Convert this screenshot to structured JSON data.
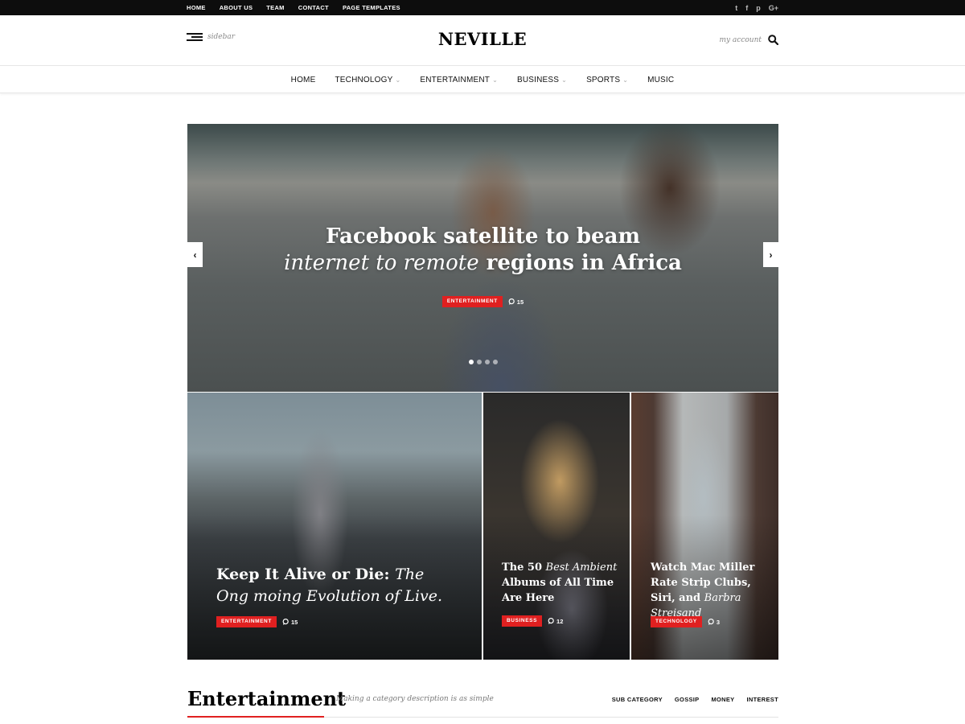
{
  "top_nav": [
    "HOME",
    "ABOUT US",
    "TEAM",
    "CONTACT",
    "PAGE TEMPLATES"
  ],
  "social": [
    {
      "icon": "twitter-icon",
      "glyph": "t"
    },
    {
      "icon": "facebook-icon",
      "glyph": "f"
    },
    {
      "icon": "pinterest-icon",
      "glyph": "p"
    },
    {
      "icon": "google-plus-icon",
      "glyph": "G+"
    }
  ],
  "header": {
    "sidebar_label": "sidebar",
    "logo": "NEVILLE",
    "account_label": "my account"
  },
  "main_nav": {
    "home": "HOME",
    "technology": "TECHNOLOGY",
    "entertainment": "ENTERTAINMENT",
    "business": "BUSINESS",
    "sports": "SPORTS",
    "music": "MUSIC",
    "chevron": "⌄"
  },
  "hero": {
    "title_line1": "Facebook satellite to beam",
    "title_line2_italic": "internet to remote",
    "title_line2_rest": " regions in Africa",
    "category": "ENTERTAINMENT",
    "comments": "15",
    "prev": "‹",
    "next": "›",
    "slide_count": 4,
    "active_slide": 1
  },
  "cards": [
    {
      "title_a": "Keep It Alive or Die: ",
      "title_b_italic": "The Ong moing Evolution of Live.",
      "title_c": "",
      "category": "ENTERTAINMENT",
      "comments": "15"
    },
    {
      "title_a": "The 50 ",
      "title_b_italic": "Best Ambient",
      "title_c": " Albums of All Time Are Here",
      "category": "BUSINESS",
      "comments": "12"
    },
    {
      "title_a": "Watch Mac Miller Rate Strip Clubs, Siri, and ",
      "title_b_italic": "Barbra Streisand",
      "title_c": "",
      "category": "TECHNOLOGY",
      "comments": "3"
    }
  ],
  "section": {
    "title": "Entertainment",
    "description": "Making a category description is as simple",
    "links": [
      "SUB CATEGORY",
      "GOSSIP",
      "MONEY",
      "INTEREST"
    ]
  },
  "colors": {
    "accent": "#e02020",
    "topbar": "#0d0d0d"
  }
}
